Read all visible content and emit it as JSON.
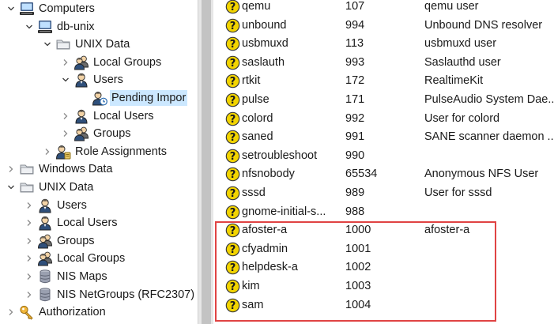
{
  "tree": [
    {
      "label": "Computers",
      "depth": 0,
      "twisty": "down",
      "icon": "computer-icon",
      "interactable": true
    },
    {
      "label": "db-unix",
      "depth": 1,
      "twisty": "down",
      "icon": "computer-icon",
      "interactable": true
    },
    {
      "label": "UNIX Data",
      "depth": 2,
      "twisty": "down",
      "icon": "folder-icon",
      "interactable": true
    },
    {
      "label": "Local Groups",
      "depth": 3,
      "twisty": "right",
      "icon": "group-icon",
      "interactable": true
    },
    {
      "label": "Users",
      "depth": 3,
      "twisty": "down",
      "icon": "user-icon",
      "interactable": true
    },
    {
      "label": "Pending Impor",
      "depth": 4,
      "twisty": "none",
      "icon": "pending-user-icon",
      "selected": true,
      "interactable": true
    },
    {
      "label": "Local Users",
      "depth": 3,
      "twisty": "right",
      "icon": "user-icon",
      "interactable": true
    },
    {
      "label": "Groups",
      "depth": 3,
      "twisty": "right",
      "icon": "group-icon",
      "interactable": true
    },
    {
      "label": "Role Assignments",
      "depth": 2,
      "twisty": "right",
      "icon": "role-icon",
      "interactable": true
    },
    {
      "label": "Windows Data",
      "depth": 0,
      "twisty": "right",
      "icon": "folder-icon",
      "interactable": true
    },
    {
      "label": "UNIX Data",
      "depth": 0,
      "twisty": "down",
      "icon": "folder-icon",
      "interactable": true
    },
    {
      "label": "Users",
      "depth": 1,
      "twisty": "right",
      "icon": "user-icon",
      "interactable": true
    },
    {
      "label": "Local Users",
      "depth": 1,
      "twisty": "right",
      "icon": "user-icon",
      "interactable": true
    },
    {
      "label": "Groups",
      "depth": 1,
      "twisty": "right",
      "icon": "group-icon",
      "interactable": true
    },
    {
      "label": "Local Groups",
      "depth": 1,
      "twisty": "right",
      "icon": "group-icon",
      "interactable": true
    },
    {
      "label": "NIS Maps",
      "depth": 1,
      "twisty": "right",
      "icon": "database-icon",
      "interactable": true
    },
    {
      "label": "NIS NetGroups (RFC2307)",
      "depth": 1,
      "twisty": "right",
      "icon": "database-icon",
      "interactable": true
    },
    {
      "label": "Authorization",
      "depth": 0,
      "twisty": "right",
      "icon": "key-icon",
      "interactable": true
    }
  ],
  "rows": [
    {
      "name": "qemu",
      "uid": "107",
      "desc": "qemu user"
    },
    {
      "name": "unbound",
      "uid": "994",
      "desc": "Unbound DNS resolver"
    },
    {
      "name": "usbmuxd",
      "uid": "113",
      "desc": "usbmuxd user"
    },
    {
      "name": "saslauth",
      "uid": "993",
      "desc": "Saslauthd user"
    },
    {
      "name": "rtkit",
      "uid": "172",
      "desc": "RealtimeKit"
    },
    {
      "name": "pulse",
      "uid": "171",
      "desc": "PulseAudio System Dae..."
    },
    {
      "name": "colord",
      "uid": "992",
      "desc": "User for colord"
    },
    {
      "name": "saned",
      "uid": "991",
      "desc": "SANE scanner daemon ..."
    },
    {
      "name": "setroubleshoot",
      "uid": "990",
      "desc": ""
    },
    {
      "name": "nfsnobody",
      "uid": "65534",
      "desc": "Anonymous NFS User"
    },
    {
      "name": "sssd",
      "uid": "989",
      "desc": "User for sssd"
    },
    {
      "name": "gnome-initial-s...",
      "uid": "988",
      "desc": ""
    },
    {
      "name": "afoster-a",
      "uid": "1000",
      "desc": "afoster-a"
    },
    {
      "name": "cfyadmin",
      "uid": "1001",
      "desc": ""
    },
    {
      "name": "helpdesk-a",
      "uid": "1002",
      "desc": ""
    },
    {
      "name": "kim",
      "uid": "1003",
      "desc": ""
    },
    {
      "name": "sam",
      "uid": "1004",
      "desc": ""
    }
  ],
  "colors": {
    "selection": "#cce8ff",
    "highlight_box": "#e04343",
    "unknown_user_icon": "#f2d400"
  }
}
